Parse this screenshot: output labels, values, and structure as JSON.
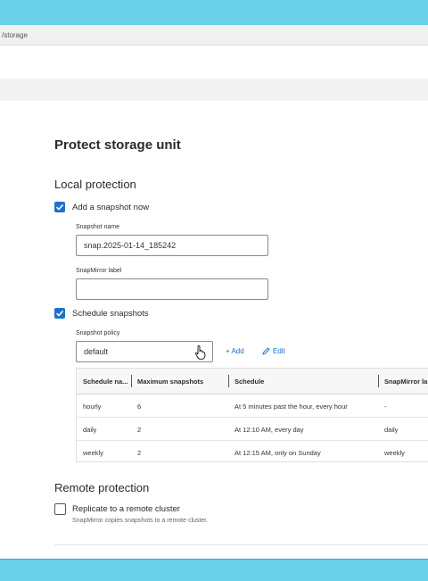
{
  "address_bar": {
    "path_fragment": "/storage"
  },
  "page": {
    "title": "Protect storage unit"
  },
  "local": {
    "heading": "Local protection",
    "add_snapshot": {
      "label": "Add a snapshot now",
      "checked": true
    },
    "snapshot_name": {
      "label": "Snapshot name",
      "value": "snap.2025-01-14_185242"
    },
    "snapmirror_label": {
      "label": "SnapMirror label",
      "value": ""
    },
    "schedule_snapshots": {
      "label": "Schedule snapshots",
      "checked": true
    },
    "snapshot_policy": {
      "label": "Snapshot policy",
      "value": "default",
      "add_label": "+ Add",
      "edit_label": "Edit"
    },
    "schedule_table": {
      "columns": [
        "Schedule na...",
        "Maximum snapshots",
        "Schedule",
        "SnapMirror la"
      ],
      "rows": [
        [
          "hourly",
          "6",
          "At 5 minutes past the hour, every hour",
          "-"
        ],
        [
          "daily",
          "2",
          "At 12:10 AM, every day",
          "daily"
        ],
        [
          "weekly",
          "2",
          "At 12:15 AM, only on Sunday",
          "weekly"
        ]
      ]
    }
  },
  "remote": {
    "heading": "Remote protection",
    "replicate": {
      "label": "Replicate to a remote cluster",
      "checked": false,
      "description": "SnapMirror copies snapshots to a remote cluster."
    }
  },
  "colors": {
    "accent": "#1a73c9",
    "frame": "#6ad0ea",
    "link": "#1a6fc2"
  },
  "icons": {
    "checkbox_checked": "checkmark-icon",
    "edit": "pencil-icon",
    "dropdown": "chevron-down-icon",
    "pointer": "hand-cursor-icon"
  }
}
